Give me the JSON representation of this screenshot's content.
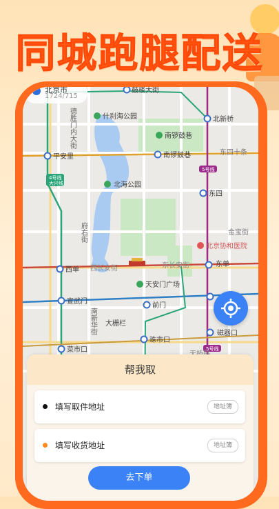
{
  "promo": {
    "title": "同城跑腿配送"
  },
  "map": {
    "current_city": "北京市",
    "current_sub": "1724/715",
    "labels": {
      "gulou": "鼓楼大街",
      "shichahai": "什刹海公园",
      "xinjiekou": "德胜门内大街",
      "beixinqiao": "北新桥",
      "nanluoguxiang1": "南锣鼓巷",
      "pinganli": "平安里",
      "nanluoguxiang2": "南锣鼓巷",
      "dongsishitiao": "东四十条",
      "line4": "4号线",
      "daxing": "大兴线",
      "line5a": "5号线",
      "beihai": "北海公园",
      "dongsi": "东四",
      "fuyoujie": "府右街",
      "jinbao": "金宝街",
      "pumch": "北京协和医院",
      "xidan": "西单",
      "xichangan": "西长安街",
      "dongchangan": "东长安街",
      "dongdan": "东单",
      "tiananmen": "天安门广场",
      "xuanwumen": "宣武门",
      "qianmen": "前门",
      "nanxinhua": "南新华街",
      "dashilan": "大栅栏",
      "caishikou": "菜市口",
      "zhushikou": "珠市口",
      "ciqikou": "磁器口",
      "line5b": "5号线",
      "tianqiao": "天桥路"
    }
  },
  "panel": {
    "title": "帮我取",
    "pickup": {
      "label": "填写取件地址",
      "book": "地址簿",
      "dot_color": "#111111"
    },
    "delivery": {
      "label": "填写收货地址",
      "book": "地址簿",
      "dot_color": "#ff8a1e"
    },
    "submit": "去下单"
  },
  "colors": {
    "accent": "#ff5a14",
    "primary": "#3b82f6"
  }
}
